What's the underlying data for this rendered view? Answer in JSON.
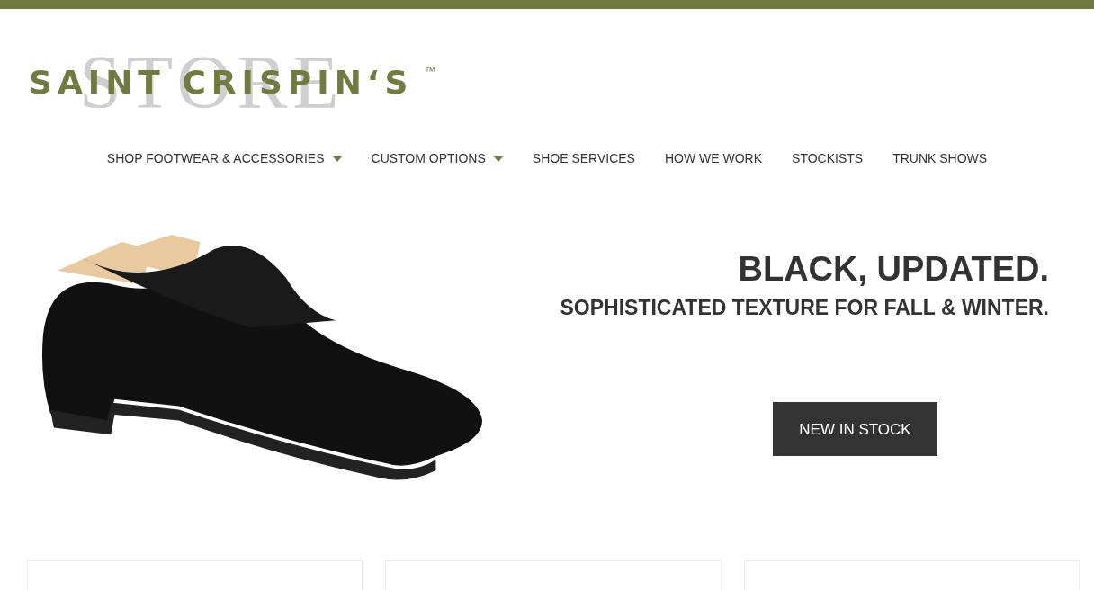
{
  "logo": {
    "name": "SAINT CRISPIN‘S",
    "trademark": "™",
    "backdrop": "STORE"
  },
  "nav": [
    {
      "label": "SHOP FOOTWEAR & ACCESSORIES",
      "dropdown": true
    },
    {
      "label": "CUSTOM OPTIONS",
      "dropdown": true
    },
    {
      "label": "SHOE SERVICES",
      "dropdown": false
    },
    {
      "label": "HOW WE WORK",
      "dropdown": false
    },
    {
      "label": "STOCKISTS",
      "dropdown": false
    },
    {
      "label": "TRUNK SHOWS",
      "dropdown": false
    }
  ],
  "hero": {
    "headline": "BLACK, UPDATED.",
    "subheadline": "SOPHISTICATED TEXTURE FOR FALL & WINTER.",
    "button": "NEW IN STOCK"
  },
  "cards": [
    {
      "kind": "empty"
    },
    {
      "kind": "empty"
    },
    {
      "kind": "empty"
    }
  ]
}
